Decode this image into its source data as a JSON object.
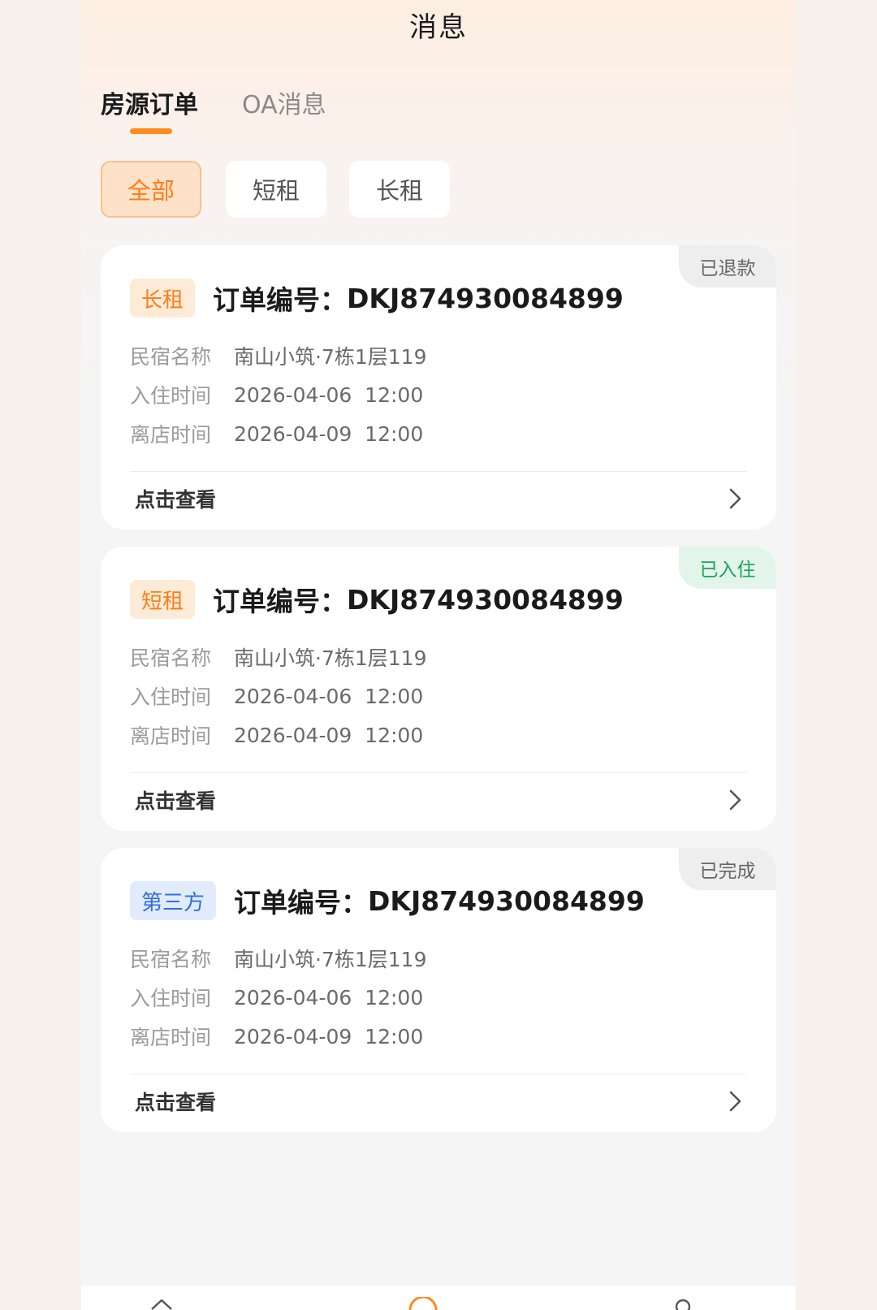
{
  "header": {
    "title": "消息"
  },
  "tabs": [
    {
      "label": "房源订单",
      "active": true
    },
    {
      "label": "OA消息",
      "active": false
    }
  ],
  "filters": [
    {
      "label": "全部",
      "active": true
    },
    {
      "label": "短租",
      "active": false
    },
    {
      "label": "长租",
      "active": false
    }
  ],
  "cards": [
    {
      "status": "已退款",
      "type_tag": "长租",
      "order_label": "订单编号：",
      "order_no": "DKJ874930084899",
      "rows": [
        {
          "key": "民宿名称",
          "value": "南山小筑·7栋1层119"
        },
        {
          "key": "入住时间",
          "value": "2026-04-06  12:00"
        },
        {
          "key": "离店时间",
          "value": "2026-04-09  12:00"
        }
      ],
      "action": "点击查看"
    },
    {
      "status": "已入住",
      "type_tag": "短租",
      "order_label": "订单编号：",
      "order_no": "DKJ874930084899",
      "rows": [
        {
          "key": "民宿名称",
          "value": "南山小筑·7栋1层119"
        },
        {
          "key": "入住时间",
          "value": "2026-04-06  12:00"
        },
        {
          "key": "离店时间",
          "value": "2026-04-09  12:00"
        }
      ],
      "action": "点击查看"
    },
    {
      "status": "已完成",
      "type_tag": "第三方",
      "order_label": "订单编号：",
      "order_no": "DKJ874930084899",
      "rows": [
        {
          "key": "民宿名称",
          "value": "南山小筑·7栋1层119"
        },
        {
          "key": "入住时间",
          "value": "2026-04-06  12:00"
        },
        {
          "key": "离店时间",
          "value": "2026-04-09  12:00"
        }
      ],
      "action": "点击查看"
    }
  ],
  "colors": {
    "accent": "#ff8a1f",
    "status_green": "#1aa45c",
    "third_party_blue": "#2f6fe0"
  },
  "icons": {
    "card_action": "chevron-right-icon",
    "nav": [
      "home-icon",
      "message-icon",
      "profile-icon"
    ]
  }
}
